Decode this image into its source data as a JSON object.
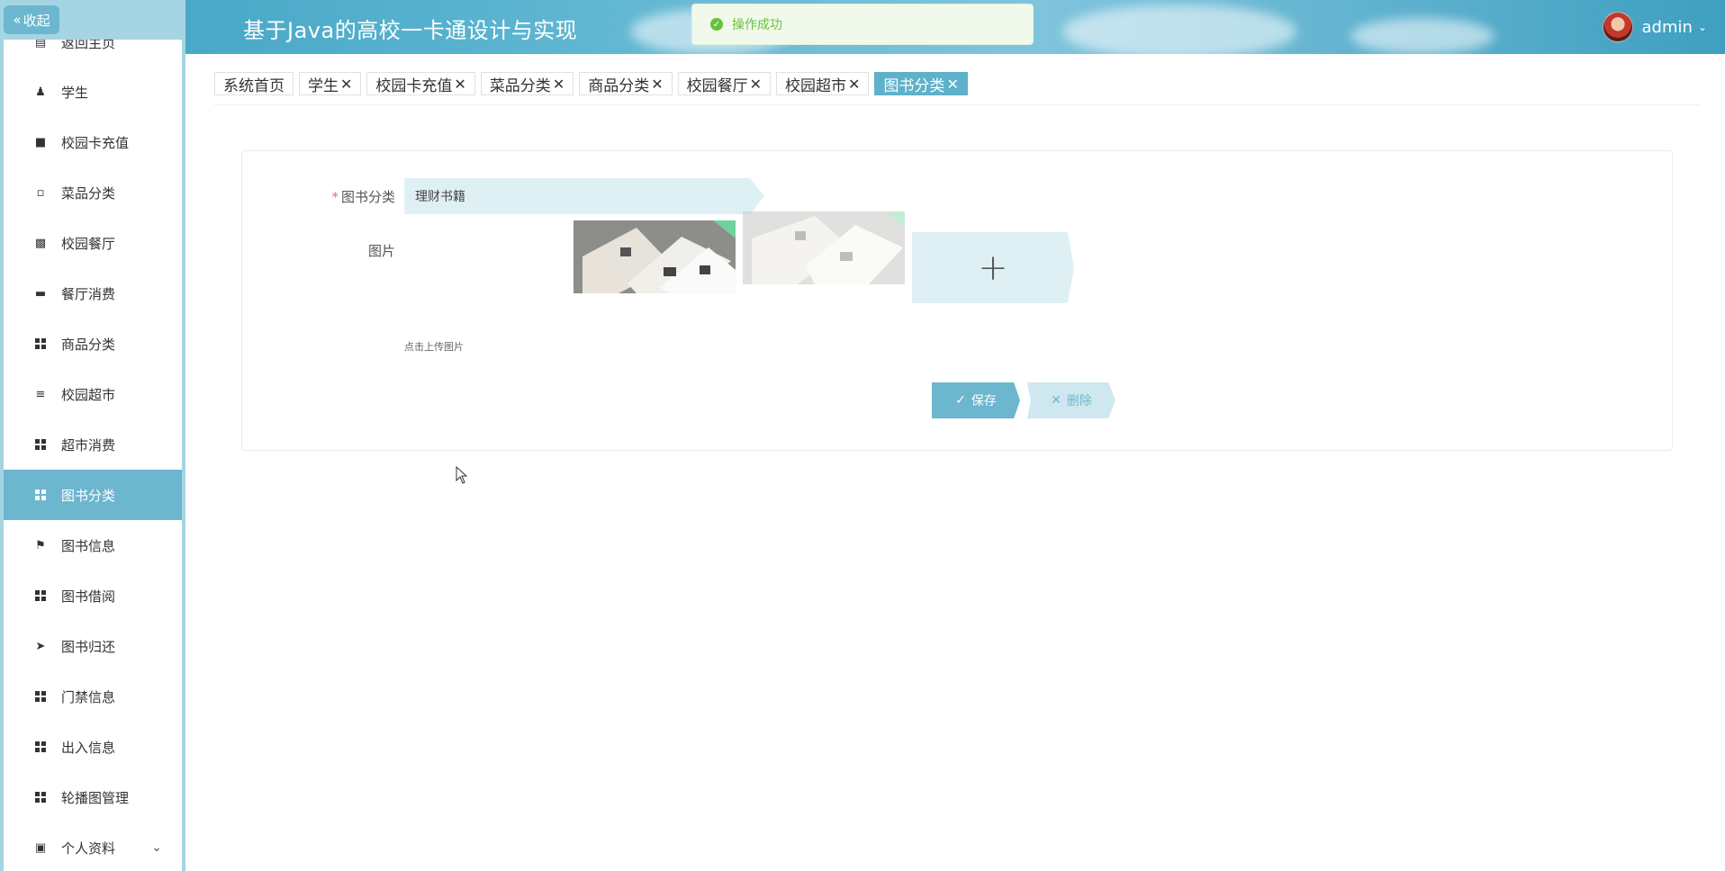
{
  "app": {
    "title": "基于Java的高校一卡通设计与实现"
  },
  "user": {
    "name": "admin"
  },
  "toast": {
    "message": "操作成功"
  },
  "sidebar": {
    "collapse_label": "收起",
    "items": [
      {
        "label": "返回主页",
        "icon": "home-icon"
      },
      {
        "label": "学生",
        "icon": "user-icon"
      },
      {
        "label": "校园卡充值",
        "icon": "card-icon"
      },
      {
        "label": "菜品分类",
        "icon": "message-icon"
      },
      {
        "label": "校园餐厅",
        "icon": "clipboard-icon"
      },
      {
        "label": "餐厅消费",
        "icon": "monitor-icon"
      },
      {
        "label": "商品分类",
        "icon": "grid-icon"
      },
      {
        "label": "校园超市",
        "icon": "list-icon"
      },
      {
        "label": "超市消费",
        "icon": "grid-icon"
      },
      {
        "label": "图书分类",
        "icon": "grid-icon",
        "active": true
      },
      {
        "label": "图书信息",
        "icon": "flag-icon"
      },
      {
        "label": "图书借阅",
        "icon": "grid-icon"
      },
      {
        "label": "图书归还",
        "icon": "send-icon"
      },
      {
        "label": "门禁信息",
        "icon": "grid-icon"
      },
      {
        "label": "出入信息",
        "icon": "grid-icon"
      },
      {
        "label": "轮播图管理",
        "icon": "grid-icon"
      },
      {
        "label": "个人资料",
        "icon": "folder-icon",
        "expandable": true
      }
    ]
  },
  "tags": [
    {
      "label": "系统首页",
      "closable": false
    },
    {
      "label": "学生",
      "closable": true
    },
    {
      "label": "校园卡充值",
      "closable": true
    },
    {
      "label": "菜品分类",
      "closable": true
    },
    {
      "label": "商品分类",
      "closable": true
    },
    {
      "label": "校园餐厅",
      "closable": true
    },
    {
      "label": "校园超市",
      "closable": true
    },
    {
      "label": "图书分类",
      "closable": true,
      "active": true
    }
  ],
  "form": {
    "category_label": "图书分类",
    "category_value": "理财书籍",
    "image_label": "图片",
    "upload_tip": "点击上传图片",
    "save_label": "保存",
    "delete_label": "删除"
  },
  "colors": {
    "accent": "#6cb6ce",
    "toast_success": "#67c23a",
    "required": "#f56c6c"
  }
}
